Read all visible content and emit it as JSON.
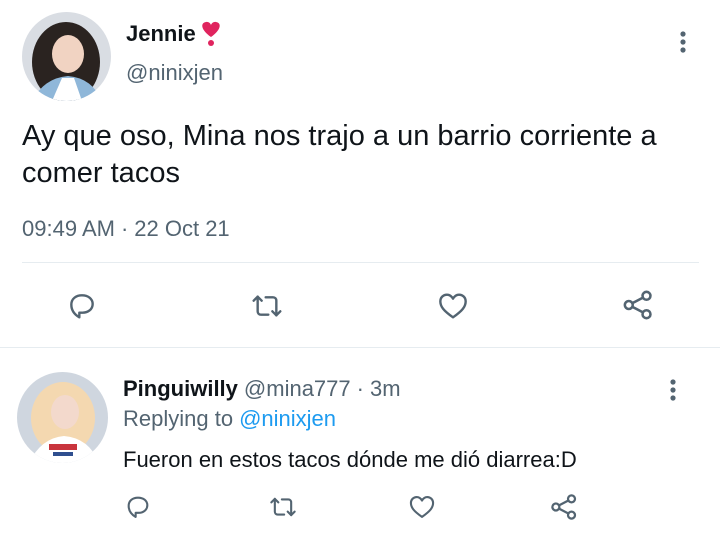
{
  "main_tweet": {
    "author_name": "Jennie",
    "author_handle": "@ninixjen",
    "text": "Ay que oso, Mina nos trajo a un barrio corriente a comer tacos",
    "time": "09:49 AM",
    "separator": "·",
    "date": "22 Oct 21",
    "name_emoji": "heart-exclamation-icon"
  },
  "reply": {
    "author_name": "Pinguiwilly",
    "author_handle": "@mina777",
    "separator": "·",
    "age": "3m",
    "replying_prefix": "Replying to",
    "replying_to": "@ninixjen",
    "text": "Fueron en estos tacos dónde me dió diarrea:D"
  },
  "actions": [
    "reply-icon",
    "retweet-icon",
    "like-icon",
    "share-icon"
  ],
  "colors": {
    "text": "#0f1419",
    "secondary": "#536471",
    "accent": "#1d9bf0",
    "heart": "#e0245e",
    "divider": "#e6ecf0"
  }
}
